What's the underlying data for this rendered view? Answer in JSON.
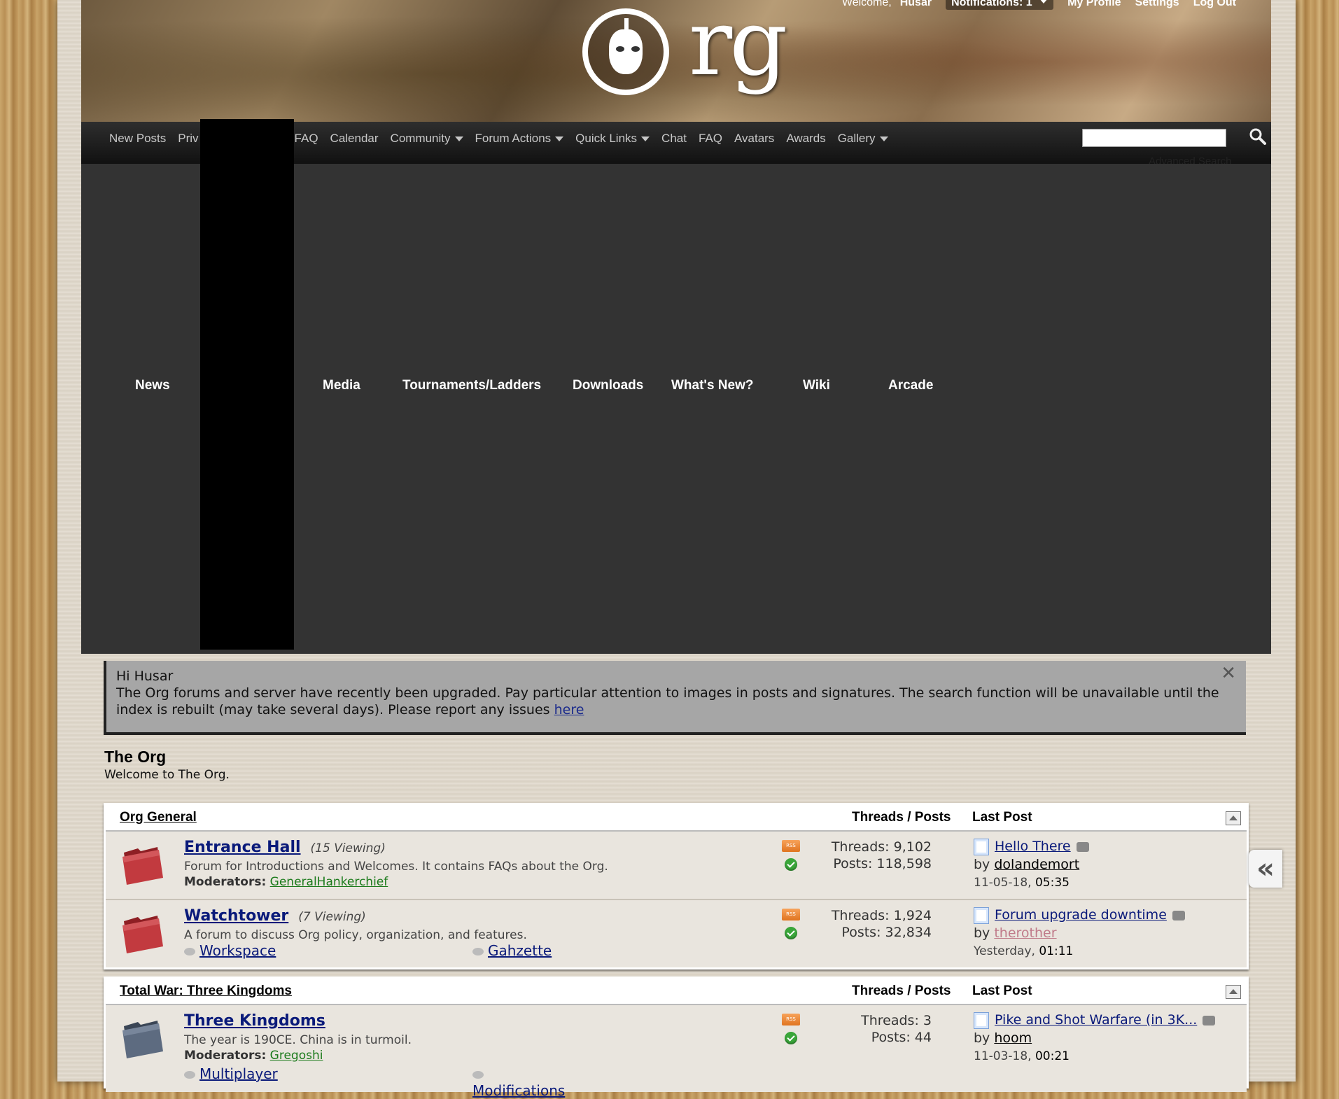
{
  "userbar": {
    "welcome": "Welcome,",
    "username": "Husar",
    "notifications": "Notifications: 1",
    "my_profile": "My Profile",
    "settings": "Settings",
    "logout": "Log Out"
  },
  "logo": {
    "text": "rg"
  },
  "navbar": {
    "tabs": [
      "New Posts",
      "Priv",
      "FAQ",
      "Calendar",
      "Community",
      "Forum Actions",
      "Quick Links",
      "Chat",
      "FAQ",
      "Avatars",
      "Awards",
      "Gallery"
    ],
    "search_placeholder": "",
    "advanced_search": "Advanced Search"
  },
  "megamenu": {
    "links": [
      "News",
      "Media",
      "Tournaments/Ladders",
      "Downloads",
      "What's New?",
      "Wiki",
      "Arcade"
    ]
  },
  "notice": {
    "greeting": "Hi Husar",
    "message": "The Org forums and server have recently been upgraded. Pay particular attention to images in posts and signatures. The search function will be unavailable until the index is rebuilt (may take several days). Please report any issues ",
    "link": "here",
    "close": "✕"
  },
  "forum": {
    "title": "The Org",
    "subtitle": "Welcome to The Org."
  },
  "categories": [
    {
      "name": "Org General",
      "col_threads_posts": "Threads / Posts",
      "col_last_post": "Last Post",
      "forums": [
        {
          "title": "Entrance Hall",
          "viewing": "(15 Viewing)",
          "description": "Forum for Introductions and Welcomes. It contains FAQs about the Org.",
          "moderators_label": "Moderators:",
          "moderators": "GeneralHankerchief",
          "threads": "Threads: 9,102",
          "posts": "Posts: 118,598",
          "last_post_title": "Hello There",
          "last_post_by": "by",
          "last_post_user": "dolandemort",
          "last_post_date": "11-05-18,",
          "last_post_time": "05:35"
        },
        {
          "title": "Watchtower",
          "viewing": "(7 Viewing)",
          "description": "A forum to discuss Org policy, organization, and features.",
          "subforums": [
            "Workspace",
            "Gahzette"
          ],
          "threads": "Threads: 1,924",
          "posts": "Posts: 32,834",
          "last_post_title": "Forum upgrade downtime",
          "last_post_by": "by",
          "last_post_user": "therother",
          "last_post_date": "Yesterday,",
          "last_post_time": "01:11"
        }
      ]
    },
    {
      "name": "Total War: Three Kingdoms",
      "col_threads_posts": "Threads / Posts",
      "col_last_post": "Last Post",
      "forums": [
        {
          "title": "Three Kingdoms",
          "description": "The year is 190CE. China is in turmoil.",
          "moderators_label": "Moderators:",
          "moderators": "Gregoshi",
          "subforums": [
            "Multiplayer",
            "Modifications"
          ],
          "threads": "Threads: 3",
          "posts": "Posts: 44",
          "last_post_title": "Pike and Shot Warfare (in 3K...",
          "last_post_by": "by",
          "last_post_user": "hoom",
          "last_post_date": "11-03-18,",
          "last_post_time": "00:21"
        }
      ]
    }
  ],
  "side_arrow": "«",
  "colors": {
    "link": "#0a1a7a",
    "moderator": "#1b7a1b",
    "navbar": "#1a1a1a",
    "mega_bg": "#333333"
  }
}
